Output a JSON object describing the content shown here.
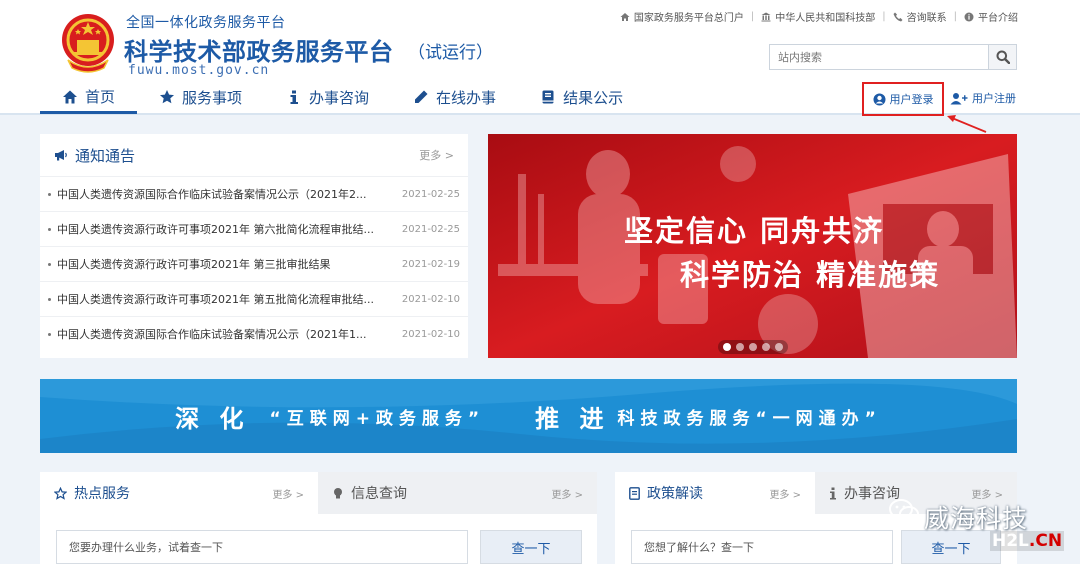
{
  "header": {
    "pre_title": "全国一体化政务服务平台",
    "title": "科学技术部政务服务平台",
    "trial": "（试运行）",
    "domain": "fuwu.most.gov.cn",
    "top_links": [
      "国家政务服务平台总门户",
      "中华人民共和国科技部",
      "咨询联系",
      "平台介绍"
    ],
    "search_placeholder": "站内搜索"
  },
  "nav": {
    "items": [
      "首页",
      "服务事项",
      "办事咨询",
      "在线办事",
      "结果公示"
    ],
    "active": 0
  },
  "account": {
    "login": "用户登录",
    "register": "用户注册"
  },
  "notice": {
    "title": "通知通告",
    "more": "更多 >",
    "items": [
      {
        "title": "中国人类遗传资源国际合作临床试验备案情况公示（2021年2...",
        "date": "2021-02-25"
      },
      {
        "title": "中国人类遗传资源行政许可事项2021年 第六批简化流程审批结...",
        "date": "2021-02-25"
      },
      {
        "title": "中国人类遗传资源行政许可事项2021年 第三批审批结果",
        "date": "2021-02-19"
      },
      {
        "title": "中国人类遗传资源行政许可事项2021年 第五批简化流程审批结...",
        "date": "2021-02-10"
      },
      {
        "title": "中国人类遗传资源国际合作临床试验备案情况公示（2021年1...",
        "date": "2021-02-10"
      }
    ]
  },
  "banner": {
    "line1": "坚定信心  同舟共济",
    "line2": "科学防治  精准施策",
    "slide_count": 5,
    "active_slide": 0
  },
  "slogan": {
    "p1": "深 化",
    "p2": "“互联网+政务服务”",
    "p3": "推 进",
    "p4": "科技政务服务“一网通办”"
  },
  "services": {
    "tab1": "热点服务",
    "tab2": "信息查询",
    "more": "更多 >",
    "placeholder": "您要办理什么业务，试着查一下",
    "button": "查一下"
  },
  "policy": {
    "tab1": "政策解读",
    "tab2": "办事咨询",
    "more": "更多 >",
    "placeholder": "您想了解什么？查一下",
    "button": "查一下"
  },
  "watermark": {
    "text": "威海科技",
    "site_a": "H2L",
    "site_b": ".CN"
  },
  "colors": {
    "primary": "#1d5aa6",
    "banner_red": "#c8141a",
    "slogan_blue": "#1e8fd4",
    "highlight": "#e02020"
  }
}
